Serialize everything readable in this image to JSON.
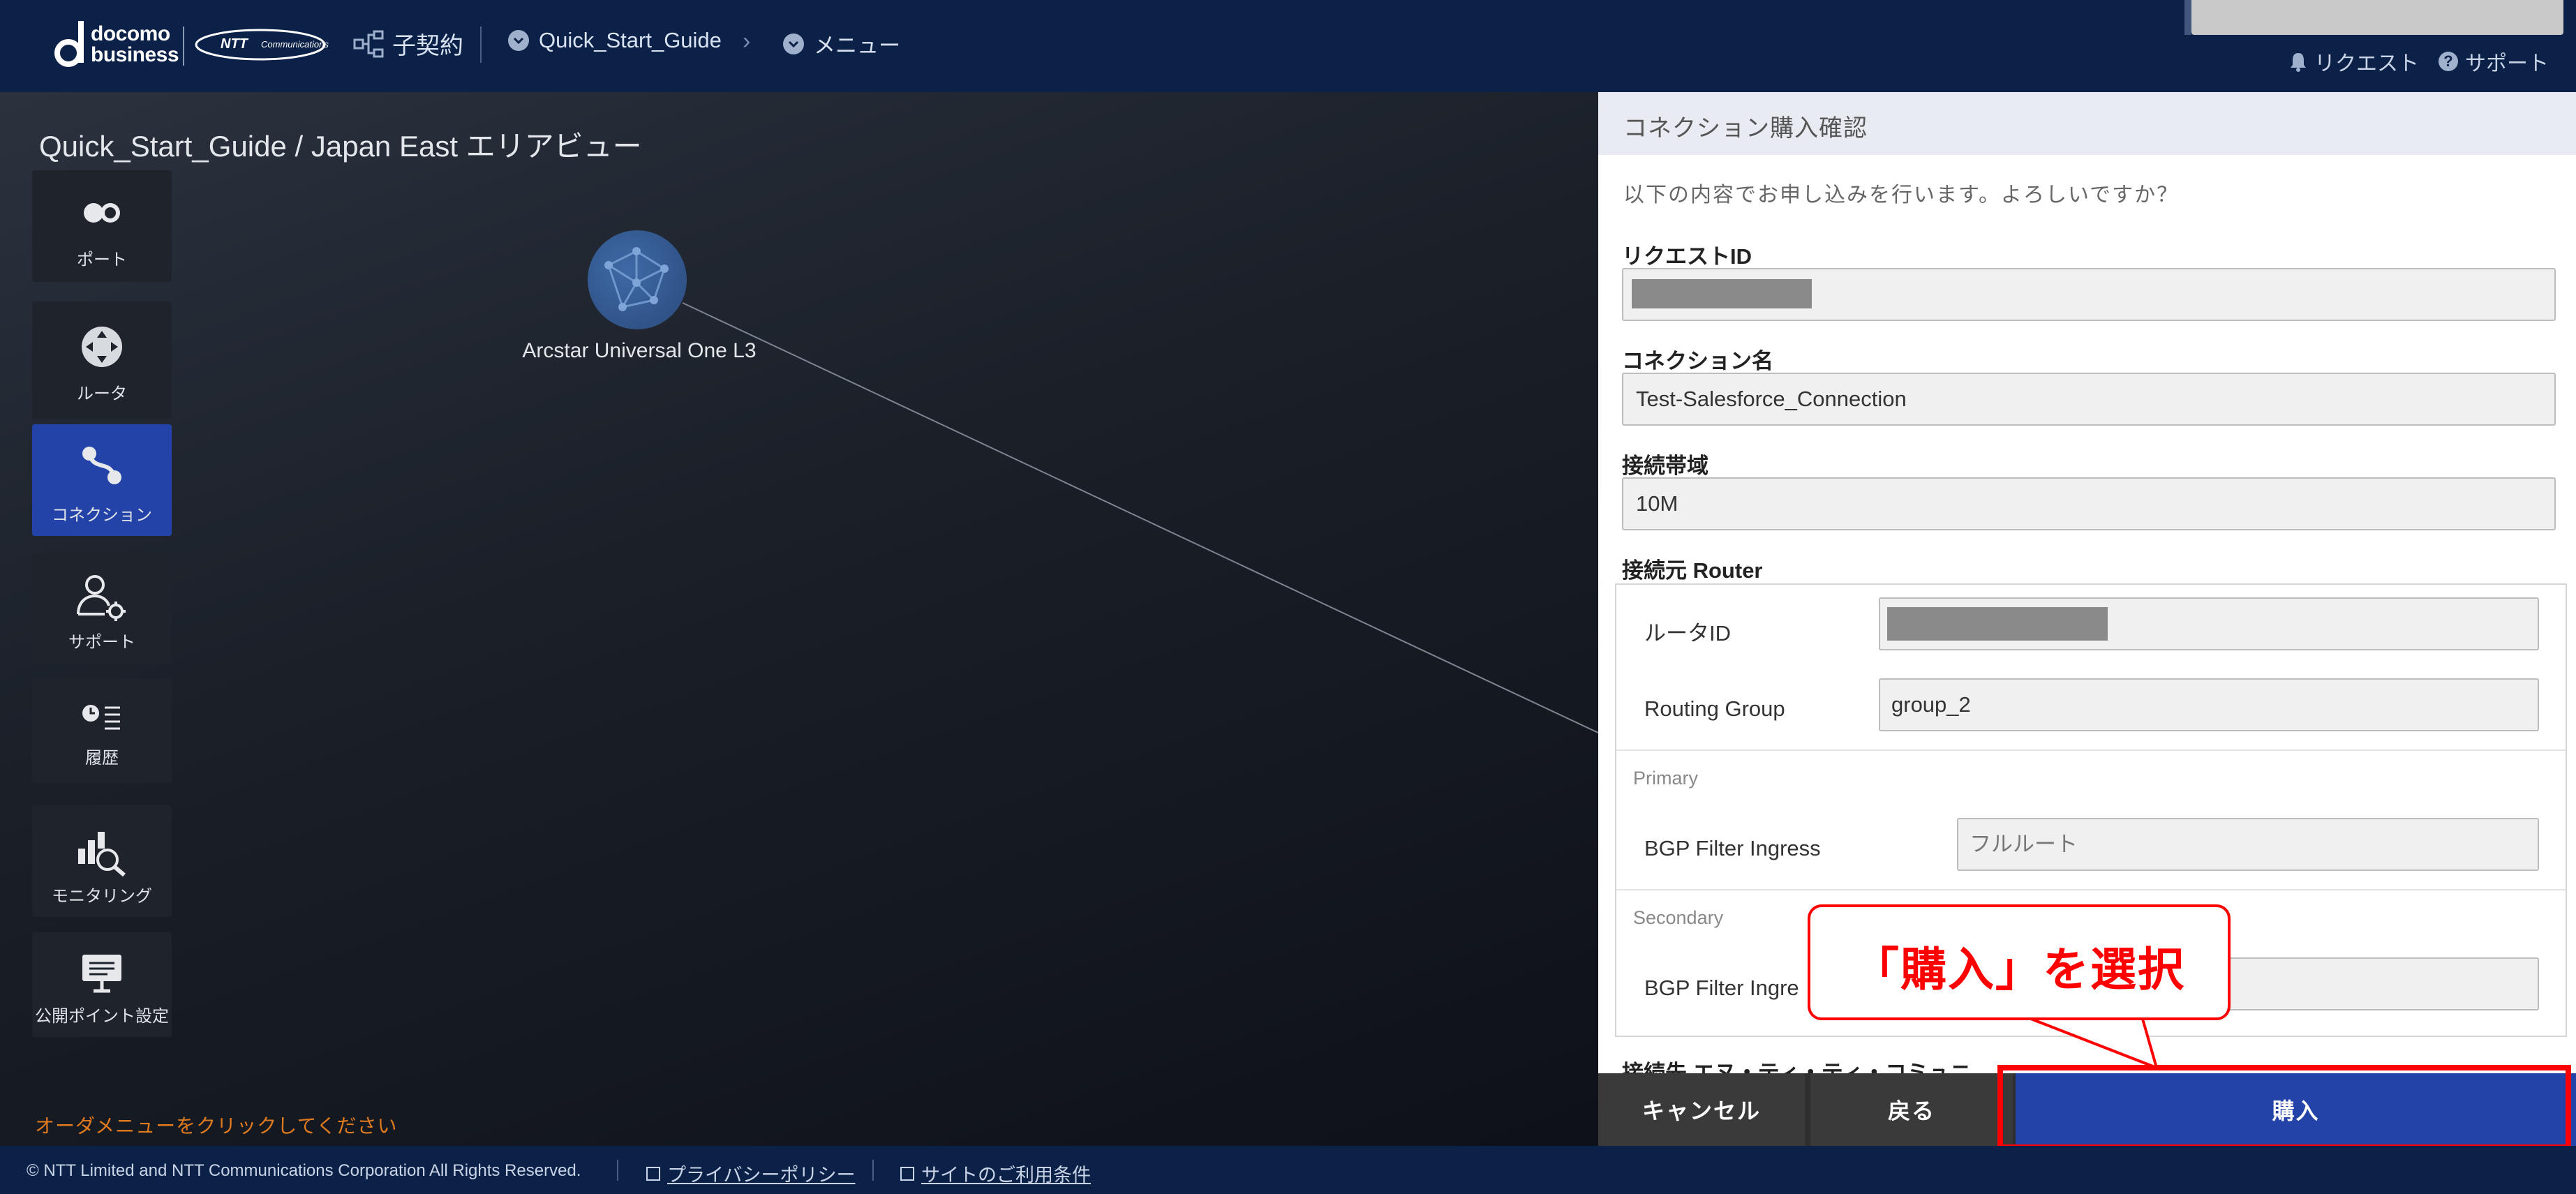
{
  "header": {
    "brand_line1": "docomo",
    "brand_line2": "business",
    "ntt_logo": "NTT",
    "ntt_logo_sub": "Communications",
    "contract_label": "子契約",
    "breadcrumb": [
      {
        "label": "Quick_Start_Guide"
      },
      {
        "label": "メニュー"
      }
    ],
    "request_link": "リクエスト",
    "support_link": "サポート",
    "help_icon_glyph": "?"
  },
  "canvas": {
    "title": "Quick_Start_Guide / Japan East エリアビュー",
    "node_label": "Arcstar Universal One L3",
    "sidebar": [
      {
        "label": "ポート",
        "icon": "port-icon"
      },
      {
        "label": "ルータ",
        "icon": "router-icon"
      },
      {
        "label": "コネクション",
        "icon": "connection-icon",
        "active": true
      },
      {
        "label": "サポート",
        "icon": "support-user-icon"
      },
      {
        "label": "履歴",
        "icon": "history-icon"
      },
      {
        "label": "モニタリング",
        "icon": "monitoring-icon"
      },
      {
        "label": "公開ポイント設定",
        "icon": "public-point-icon"
      }
    ],
    "order_hint": "オーダメニューをクリックしてください"
  },
  "panel": {
    "title": "コネクション購入確認",
    "intro": "以下の内容でお申し込みを行います。よろしいですか？",
    "request_id_label": "リクエストID",
    "connection_name_label": "コネクション名",
    "connection_name_value": "Test-Salesforce_Connection",
    "bandwidth_label": "接続帯域",
    "bandwidth_value": "10M",
    "source_router_label": "接続元 Router",
    "router_id_label": "ルータID",
    "routing_group_label": "Routing Group",
    "routing_group_value": "group_2",
    "primary_label": "Primary",
    "bgp_ingress_label": "BGP Filter Ingress",
    "bgp_ingress_value": "フルルート",
    "secondary_label": "Secondary",
    "bgp_ingress_label_cut": "BGP Filter Ingre",
    "cut_bottom_label": "接続先 エヌ・ティ・ティ・コミュニ",
    "buttons": {
      "cancel": "キャンセル",
      "back": "戻る",
      "buy": "購入"
    }
  },
  "callout": {
    "text": "「購入」を選択",
    "color": "#ff0000"
  },
  "footer": {
    "copyright": "© NTT Limited and NTT Communications Corporation All Rights Reserved.",
    "privacy": "プライバシーポリシー",
    "terms": "サイトのご利用条件"
  },
  "colors": {
    "header_bg": "#0b2148",
    "accent_blue": "#2443a8",
    "hint_orange": "#e07a1f",
    "highlight_red": "#ff0000"
  }
}
